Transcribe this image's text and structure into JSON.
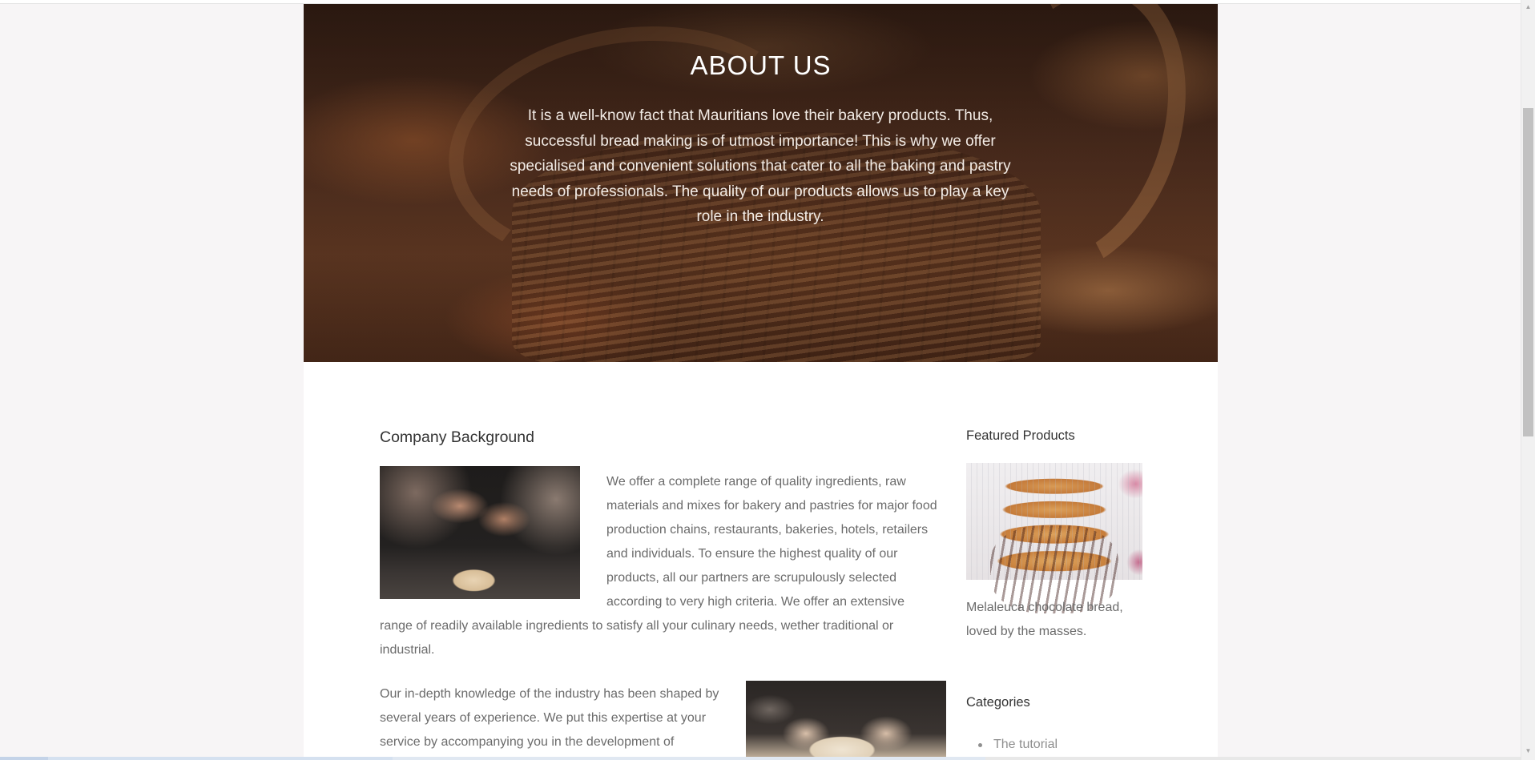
{
  "hero": {
    "title": "ABOUT US",
    "text": "It is a well-know fact that Mauritians love their bakery products. Thus, successful bread making is of utmost importance! This is why we offer specialised and convenient solutions that cater to all the baking and pastry needs of professionals. The quality of our products allows us to play a key role in the industry."
  },
  "main": {
    "section_title": "Company Background",
    "paragraph_1_wrapped": "We offer a complete range of quality ingredients, raw materials and mixes for bakery and pastries for major food production chains, restaurants, bakeries, hotels, retailers and individuals. To ensure the highest quality of our products, all our partners are scrupulously selected according to very high criteria. We offer an extensive",
    "paragraph_1_full": "range of readily available ingredients to satisfy all your culinary needs, wether traditional or industrial.",
    "paragraph_2": "Our in-depth knowledge of the industry has been shaped by several years of experience. We put this expertise at your service by accompanying you in the development of"
  },
  "sidebar": {
    "featured_title": "Featured Products",
    "product_caption": "Melaleuca chocolate bread, loved by the masses.",
    "categories_title": "Categories",
    "categories": [
      {
        "label": "The tutorial"
      }
    ]
  },
  "icons": {
    "scroll_up": "scroll-up-arrow-icon",
    "scroll_down": "scroll-down-arrow-icon"
  }
}
